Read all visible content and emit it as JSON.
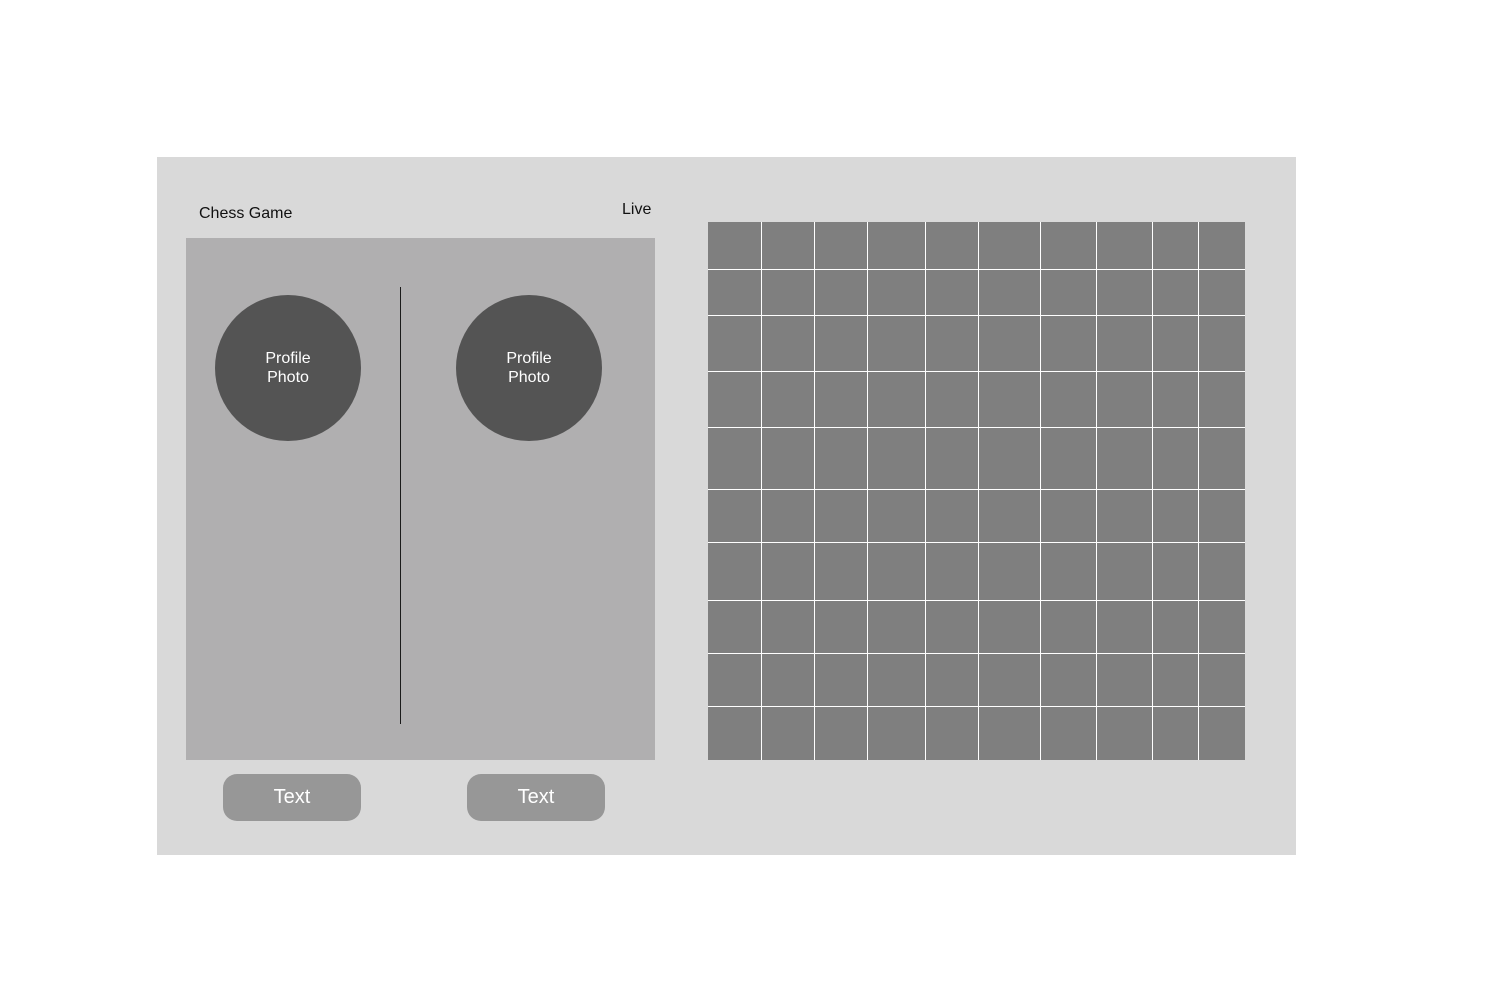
{
  "app": {
    "title": "Chess Game",
    "status": "Live"
  },
  "players": [
    {
      "photo_label": "Profile\nPhoto"
    },
    {
      "photo_label": "Profile\nPhoto"
    }
  ],
  "buttons": [
    {
      "label": "Text"
    },
    {
      "label": "Text"
    }
  ],
  "board": {
    "columns": 10,
    "rows": 10,
    "cell_color": "#7f7f7f",
    "line_color": "#ffffff"
  },
  "colors": {
    "frame_bg": "#d9d9d9",
    "panel_bg": "#b0afb0",
    "avatar_bg": "#545454",
    "button_bg": "#979797"
  }
}
